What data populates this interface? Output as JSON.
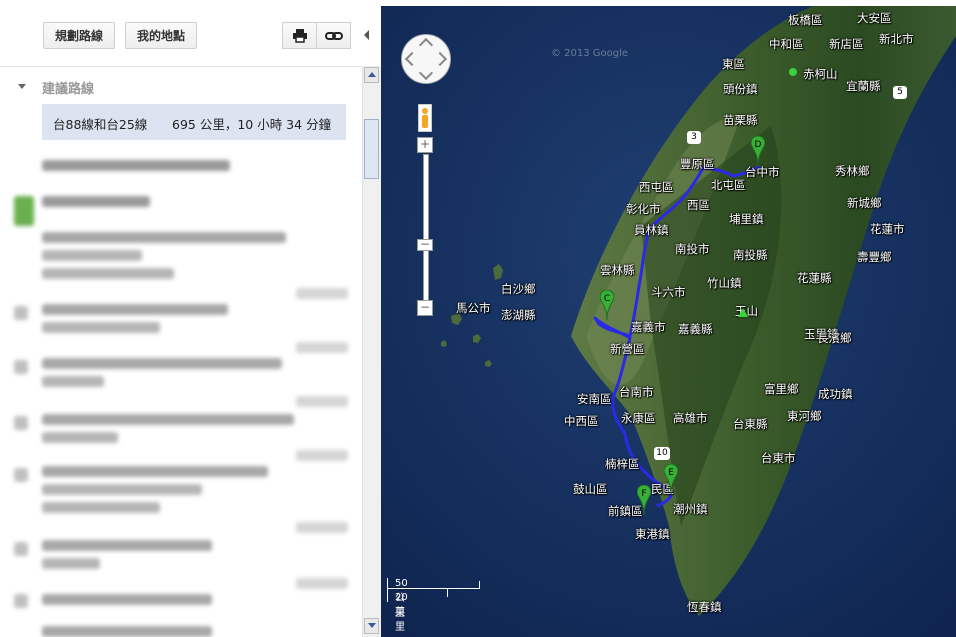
{
  "toolbar": {
    "plan_route_label": "規劃路線",
    "my_places_label": "我的地點",
    "print_icon": "print-icon",
    "link_icon": "link-icon"
  },
  "directions": {
    "section_title": "建議路線",
    "route_name": "台88線和台25線",
    "route_summary": "695 公里，10 小時 34 分鐘"
  },
  "map": {
    "copyright_text": "© 2013 Google",
    "markers": [
      "C",
      "D",
      "E",
      "F"
    ],
    "route_color": "#2a2ae6",
    "labels": [
      "板橋區",
      "大安區",
      "中和區",
      "新店區",
      "新北市",
      "東區",
      "赤柯山",
      "宜蘭縣",
      "頭份鎮",
      "苗栗縣",
      "台中市",
      "秀林鄉",
      "豐原區",
      "北屯區",
      "西屯區",
      "新城鄉",
      "彰化市",
      "西區",
      "埔里鎮",
      "花蓮市",
      "員林鎮",
      "南投市",
      "南投縣",
      "壽豐鄉",
      "白沙鄉",
      "雲林縣",
      "竹山鎮",
      "馬公市",
      "澎湖縣",
      "斗六市",
      "花蓮縣",
      "嘉義市",
      "嘉義縣",
      "玉山",
      "玉里鎮",
      "新營區",
      "長濱鄉",
      "台南市",
      "富里鄉",
      "成功鎮",
      "安南區",
      "中西區",
      "永康區",
      "高雄市",
      "台東縣",
      "東河鄉",
      "楠梓區",
      "民區",
      "台東市",
      "鼓山區",
      "潮州鎮",
      "前鎮區",
      "東港鎮",
      "恆春鎮"
    ],
    "road_shields": [
      "3",
      "5",
      "10"
    ],
    "scale_km": "50 公里",
    "scale_mi": "20 英里"
  }
}
